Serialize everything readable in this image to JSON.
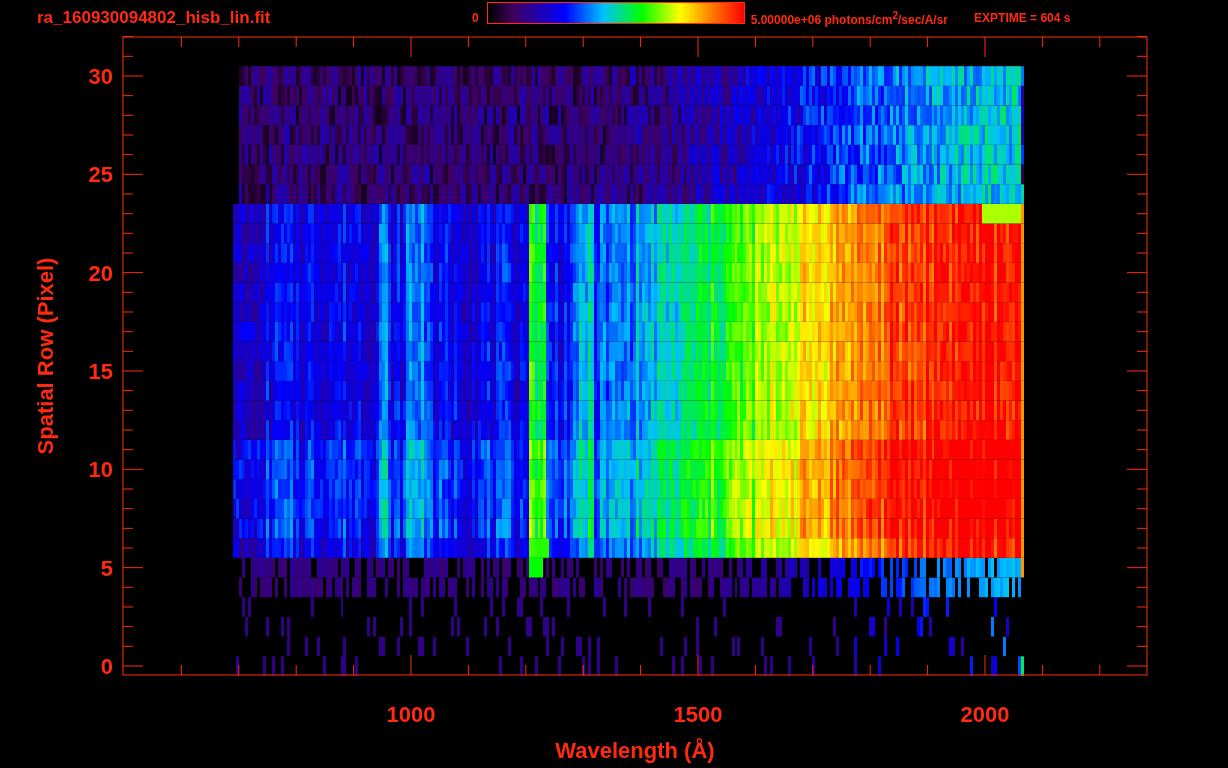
{
  "header": {
    "title": "ra_160930094802_hisb_lin.fit",
    "colorbar": {
      "min_label": "0",
      "max_label": "5.00000e+06 photons/cm$^{2}$/sec/A/sr"
    },
    "exposure": "EXPTIME = 604 s"
  },
  "plot": {
    "xlabel": "Wavelength (Å)",
    "ylabel": "Spatial Row (Pixel)",
    "xticks": [
      "1000",
      "1500",
      "2000"
    ],
    "yticks": [
      "30",
      "25",
      "20",
      "15",
      "10",
      "5",
      "0"
    ]
  }
}
